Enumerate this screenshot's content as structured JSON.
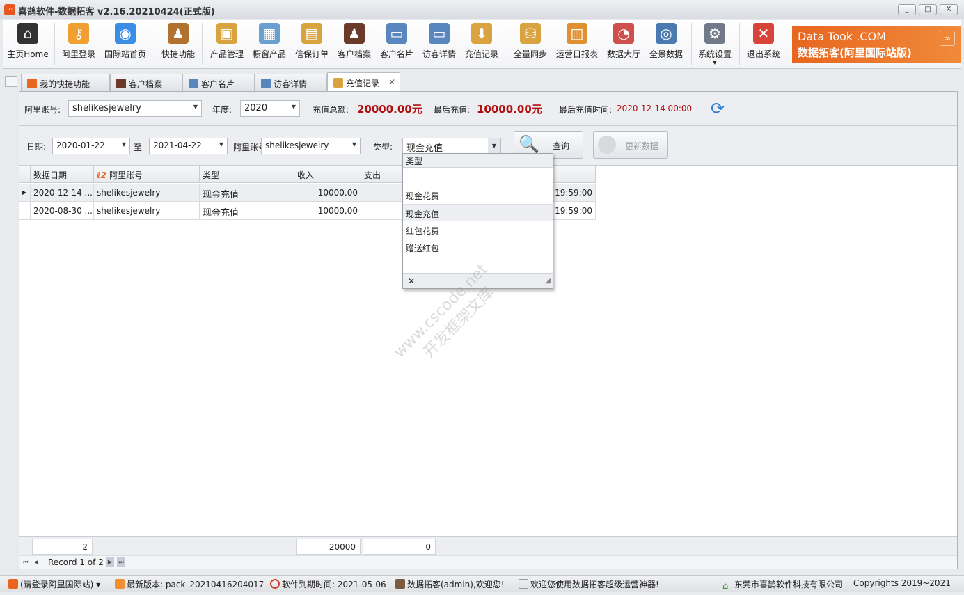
{
  "window": {
    "title": "喜鹊软件-数据拓客 v2.16.20210424(正式版)",
    "minimize": "_",
    "maximize": "□",
    "close": "X"
  },
  "toolbar": {
    "items": [
      {
        "label": "主页Home",
        "icon": "home-icon",
        "color": "#333333"
      },
      {
        "label": "阿里登录",
        "icon": "key-icon",
        "color": "#f0a030"
      },
      {
        "label": "国际站首页",
        "icon": "chrome-icon",
        "color": "#3a8ee6"
      },
      {
        "label": "快捷功能",
        "icon": "desk-user-icon",
        "color": "#b0722e"
      },
      {
        "label": "产品管理",
        "icon": "box-tag-icon",
        "color": "#d9a440"
      },
      {
        "label": "橱窗产品",
        "icon": "grid-window-icon",
        "color": "#6a9fd0"
      },
      {
        "label": "信保订单",
        "icon": "box-cart-icon",
        "color": "#d9a440"
      },
      {
        "label": "客户档案",
        "icon": "businessman-icon",
        "color": "#6b3a2a"
      },
      {
        "label": "客户名片",
        "icon": "id-card-icon",
        "color": "#5a86c0"
      },
      {
        "label": "访客详情",
        "icon": "visitor-card-icon",
        "color": "#5a86c0"
      },
      {
        "label": "充值记录",
        "icon": "inbox-download-icon",
        "color": "#d9a440"
      },
      {
        "label": "全量同步",
        "icon": "database-gear-icon",
        "color": "#d9a440"
      },
      {
        "label": "运营日报表",
        "icon": "bar-chart-icon",
        "color": "#e09030"
      },
      {
        "label": "数据大厅",
        "icon": "map-pie-icon",
        "color": "#d05050"
      },
      {
        "label": "全景数据",
        "icon": "window-eye-icon",
        "color": "#4a7ab0"
      },
      {
        "label": "系统设置",
        "icon": "users-gear-icon",
        "color": "#707a88"
      },
      {
        "label": "退出系统",
        "icon": "exit-x-icon",
        "color": "#d9443a"
      }
    ],
    "banner": {
      "line1": "Data Took .COM",
      "line2": "数据拓客(阿里国际站版)",
      "color": "#e8661f"
    }
  },
  "tabs": [
    {
      "label": "我的快捷功能",
      "icon": "ali-icon",
      "active": false
    },
    {
      "label": "客户档案",
      "icon": "businessman-icon",
      "active": false
    },
    {
      "label": "客户名片",
      "icon": "id-card-icon",
      "active": false
    },
    {
      "label": "访客详情",
      "icon": "visitor-card-icon",
      "active": false
    },
    {
      "label": "充值记录",
      "icon": "inbox-download-icon",
      "active": true,
      "close": "✕"
    }
  ],
  "summary": {
    "account_label": "阿里账号:",
    "account_value": "shelikesjewelry",
    "year_label": "年度:",
    "year_value": "2020",
    "total_label": "充值总额:",
    "total_value": "20000.00元",
    "last_label": "最后充值:",
    "last_value": "10000.00元",
    "last_time_label": "最后充值时间:",
    "last_time_value": "2020-12-14 00:00"
  },
  "filter": {
    "date_label": "日期:",
    "date_from": "2020-01-22",
    "to_label": "至",
    "date_to": "2021-04-22",
    "account_label": "阿里账号",
    "account_value": "shelikesjewelry",
    "type_label": "类型:",
    "type_value": "现金充值",
    "query_button": "查询",
    "update_button": "更新数据"
  },
  "grid": {
    "columns": [
      "数据日期",
      "阿里账号",
      "类型",
      "收入",
      "支出"
    ],
    "rows": [
      {
        "date": "2020-12-14 ...",
        "account": "shelikesjewelry",
        "type": "现金充值",
        "income": "10000.00",
        "expense": "",
        "time": "19:59:00",
        "selected": true
      },
      {
        "date": "2020-08-30 ...",
        "account": "shelikesjewelry",
        "type": "现金充值",
        "income": "10000.00",
        "expense": "",
        "time": "19:59:00",
        "selected": false
      }
    ],
    "footer": {
      "count": "2",
      "income_sum": "20000",
      "expense_sum": "0"
    },
    "navigator": {
      "record_text": "Record 1 of 2"
    }
  },
  "dropdown": {
    "header": "类型",
    "items": [
      "",
      "现金花费",
      "现金充值",
      "红包花费",
      "赠送红包"
    ],
    "selected": "现金充值",
    "clear": "✕"
  },
  "statusbar": {
    "login": "(请登录阿里国际站)",
    "version": "最新版本: pack_20210416204017",
    "expire": "软件到期时间: 2021-05-06",
    "user": "数据拓客(admin),欢迎您!",
    "welcome": "欢迎您使用数据拓客超级运营神器!",
    "company": "东莞市喜鹊软件科技有限公司",
    "copyright": "Copyrights 2019~2021"
  },
  "watermark": {
    "line1": "www.cscode.net",
    "line2": "开发框架文库"
  }
}
